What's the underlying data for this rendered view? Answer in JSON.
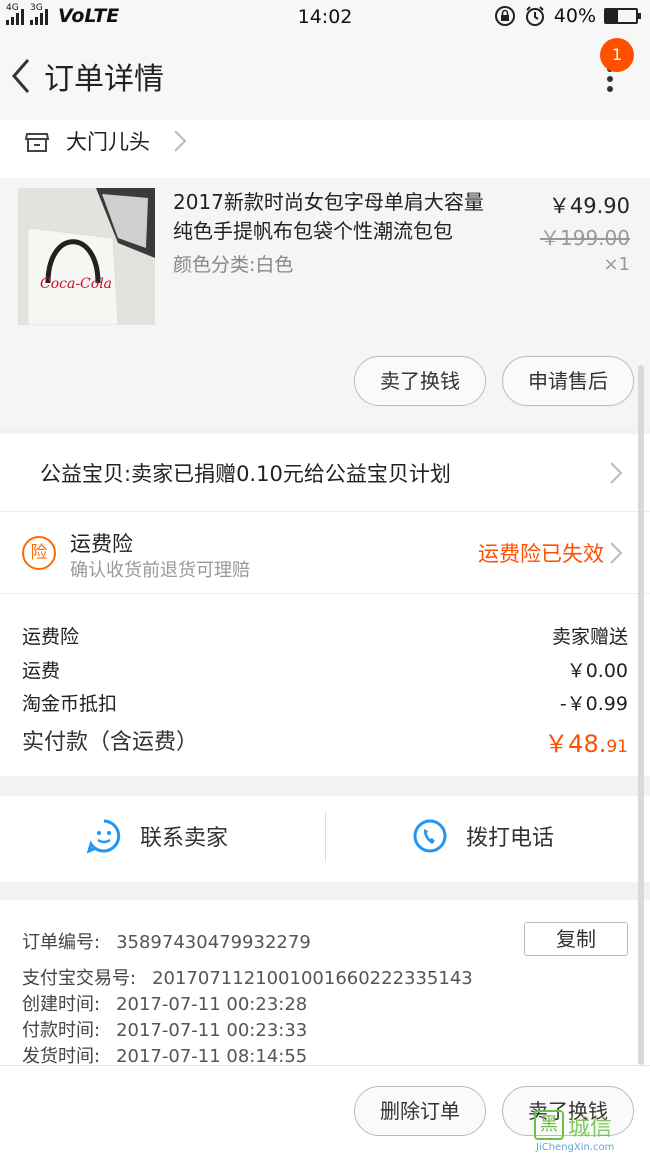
{
  "status": {
    "network": "4G",
    "network2": "3G",
    "volte": "VoLTE",
    "time": "14:02",
    "battery": "40%",
    "battery_level": 0.4
  },
  "nav": {
    "title": "订单详情",
    "badge": "1"
  },
  "shop": {
    "name": "大门儿头"
  },
  "item": {
    "title_line1": "2017新款时尚女包字母单肩大容量",
    "title_line2": "纯色手提帆布包袋个性潮流包包",
    "sku": "颜色分类:白色",
    "price": "￥49.90",
    "orig_price": "￥199.00",
    "qty": "×1",
    "actions": [
      "卖了换钱",
      "申请售后"
    ]
  },
  "charity": {
    "text": "公益宝贝:卖家已捐赠0.10元给公益宝贝计划"
  },
  "insurance": {
    "title": "运费险",
    "desc": "确认收货前退货可理赔",
    "status": "运费险已失效",
    "icon_text": "险"
  },
  "fees": [
    {
      "label": "运费险",
      "value": "卖家赠送"
    },
    {
      "label": "运费",
      "value": "￥0.00"
    },
    {
      "label": "淘金币抵扣",
      "value": "-￥0.99"
    }
  ],
  "total": {
    "label": "实付款（含运费）",
    "value_main": "￥48.",
    "value_dec": "91"
  },
  "contact": {
    "seller": "联系卖家",
    "phone": "拨打电话"
  },
  "order_info": {
    "order_no_label": "订单编号:",
    "order_no": "35897430479932279",
    "alipay_label": "支付宝交易号:",
    "alipay": "2017071121001001660222335143",
    "created_label": "创建时间:",
    "created": "2017-07-11 00:23:28",
    "paid_label": "付款时间:",
    "paid": "2017-07-11 00:23:33",
    "shipped_label": "发货时间:",
    "shipped": "2017-07-11 08:14:55",
    "copy": "复制"
  },
  "bottom": {
    "delete": "删除订单",
    "sell": "卖了换钱"
  },
  "watermark": {
    "char": "黑",
    "cn": "城信",
    "en": "JiChengXin.com"
  },
  "colors": {
    "accent": "#ff5000",
    "icon_blue": "#2196f3"
  }
}
